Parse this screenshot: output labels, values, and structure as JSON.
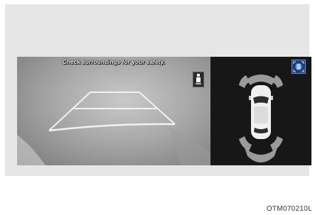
{
  "display": {
    "warning_text": "Check surroundings for your safety.",
    "icons": {
      "door": "rear-door-icon",
      "view_toggle": "view-toggle-icon"
    }
  },
  "caption": "OTM070210L",
  "colors": {
    "guide_line": "#f2f2f2",
    "sensor_zone": "#9a9a9a",
    "view_toggle_bg": "#1b3f7a"
  }
}
